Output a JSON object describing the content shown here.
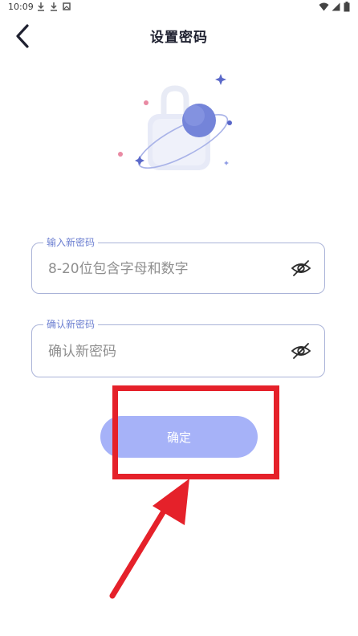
{
  "status_bar": {
    "time": "10:09",
    "left_icons": [
      "download-icon",
      "download-icon",
      "image-icon"
    ],
    "right_icons": [
      "wifi-icon",
      "signal-icon",
      "battery-icon"
    ]
  },
  "header": {
    "title": "设置密码",
    "back_icon": "chevron-left-icon"
  },
  "illustration": {
    "name": "lock-illustration"
  },
  "form": {
    "new_password": {
      "label": "输入新密码",
      "placeholder": "8-20位包含字母和数字",
      "value": "",
      "toggle_icon": "eye-off-icon"
    },
    "confirm_password": {
      "label": "确认新密码",
      "placeholder": "确认新密码",
      "value": "",
      "toggle_icon": "eye-off-icon"
    },
    "submit_label": "确定"
  },
  "colors": {
    "accent": "#6c7fd1",
    "button_disabled": "#a6b2f8",
    "annotation": "#e5212a",
    "title": "#1f2130"
  }
}
